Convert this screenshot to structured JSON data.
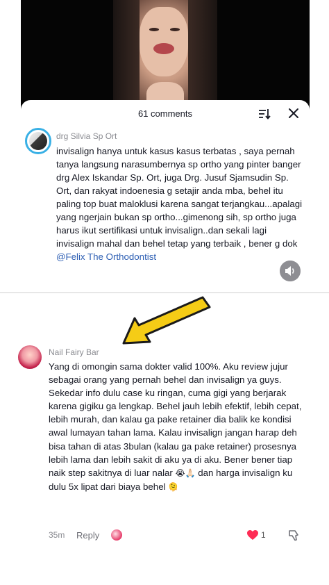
{
  "sheet": {
    "title": "61 comments"
  },
  "comments": [
    {
      "author": "drg Silvia Sp Ort",
      "text": "invisalign hanya untuk kasus kasus terbatas , saya pernah tanya langsung narasumbernya sp ortho yang pinter banger drg Alex Iskandar Sp. Ort, juga Drg. Jusuf Sjamsudin Sp. Ort, dan rakyat indoenesia g setajir anda mba, behel itu paling top buat maloklusi karena sangat terjangkau...apalagi yang ngerjain bukan sp ortho...gimenong sih, sp ortho juga harus ikut sertifikasi untuk invisalign..dan sekali lagi invisalign mahal dan behel tetap yang terbaik , bener g dok ",
      "mention": "@Felix The Orthodontist"
    },
    {
      "author": "Nail Fairy Bar",
      "text": "Yang di omongin sama dokter valid 100%. Aku review jujur sebagai orang yang pernah behel dan invisalign ya guys. Sekedar info dulu case ku ringan, cuma gigi yang berjarak karena gigiku ga lengkap. Behel jauh lebih efektif, lebih cepat, lebih murah, dan kalau ga pake retainer dia balik ke kondisi awal lumayan tahan lama. Kalau invisalign jangan harap deh bisa tahan di atas 3bulan (kalau ga pake retainer) prosesnya lebih lama dan lebih sakit di aku ya di aku. Bener bener tiap naik step sakitnya di luar nalar ",
      "emoji_1": "😭🙏🏻",
      "text_2": " dan harga invisalign ku dulu 5x lipat dari biaya behel ",
      "emoji_2": "🫠",
      "time": "35m",
      "reply_label": "Reply",
      "likes": "1"
    }
  ],
  "icons": {
    "sort": "sort-icon",
    "close": "close-icon",
    "mute": "speaker-mute-icon",
    "heart": "heart-icon",
    "dislike": "dislike-icon",
    "arrow": "yellow-arrow-annotation"
  },
  "colors": {
    "heart": "#fe2c55",
    "mention": "#2b5db3",
    "avatar_ring": "#39b0e5",
    "arrow": "#f5cc16"
  }
}
